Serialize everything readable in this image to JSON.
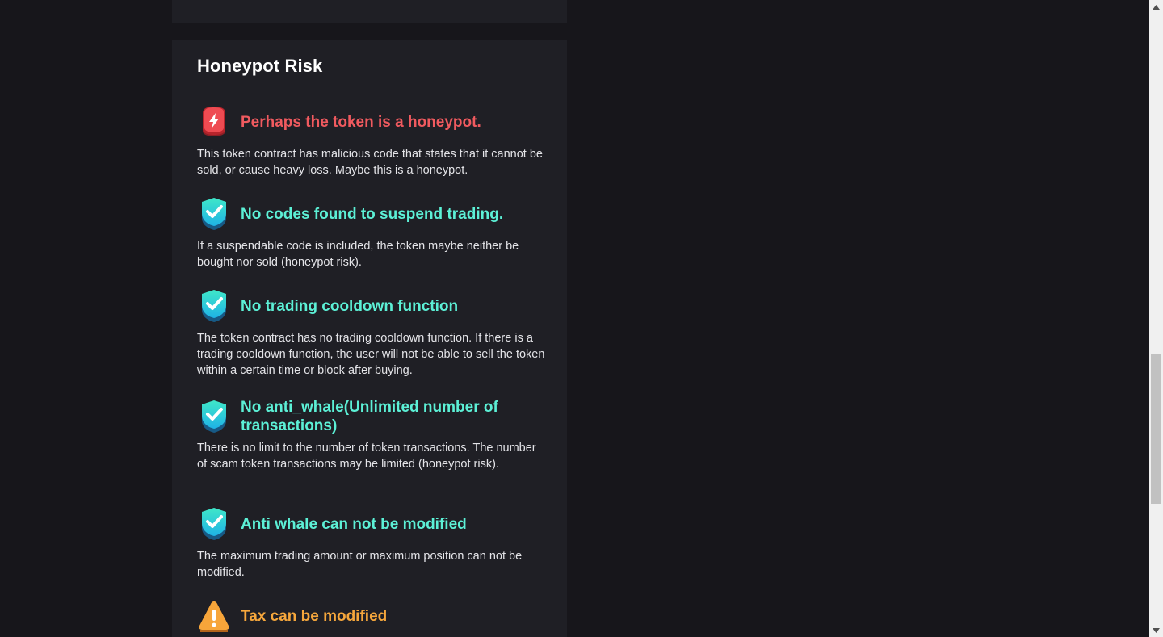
{
  "section": {
    "title": "Honeypot Risk"
  },
  "items": [
    {
      "status": "danger",
      "icon": "danger-bolt-icon",
      "title": "Perhaps the token is a honeypot.",
      "description": "This token contract has malicious code that states that it cannot be sold, or cause heavy loss. Maybe this is a honeypot."
    },
    {
      "status": "safe",
      "icon": "shield-check-icon",
      "title": "No codes found to suspend trading.",
      "description": "If a suspendable code is included, the token maybe neither be bought nor sold (honeypot risk)."
    },
    {
      "status": "safe",
      "icon": "shield-check-icon",
      "title": "No trading cooldown function",
      "description": "The token contract has no trading cooldown function. If there is a trading cooldown function, the user will not be able to sell the token within a certain time or block after buying."
    },
    {
      "status": "safe",
      "icon": "shield-check-icon",
      "title": "No anti_whale(Unlimited number of transactions)",
      "description": "There is no limit to the number of token transactions. The number of scam token transactions may be limited (honeypot risk)."
    },
    {
      "status": "safe",
      "icon": "shield-check-icon",
      "title": "Anti whale can not be modified",
      "description": "The maximum trading amount or maximum position can not be modified."
    },
    {
      "status": "warn",
      "icon": "warning-triangle-icon",
      "title": "Tax can be modified",
      "description": ""
    }
  ],
  "colors": {
    "danger": "#f05a5f",
    "safe": "#5cf0d6",
    "warn": "#f6a73c",
    "card_bg": "#1f1f25",
    "page_bg": "#17161b"
  }
}
